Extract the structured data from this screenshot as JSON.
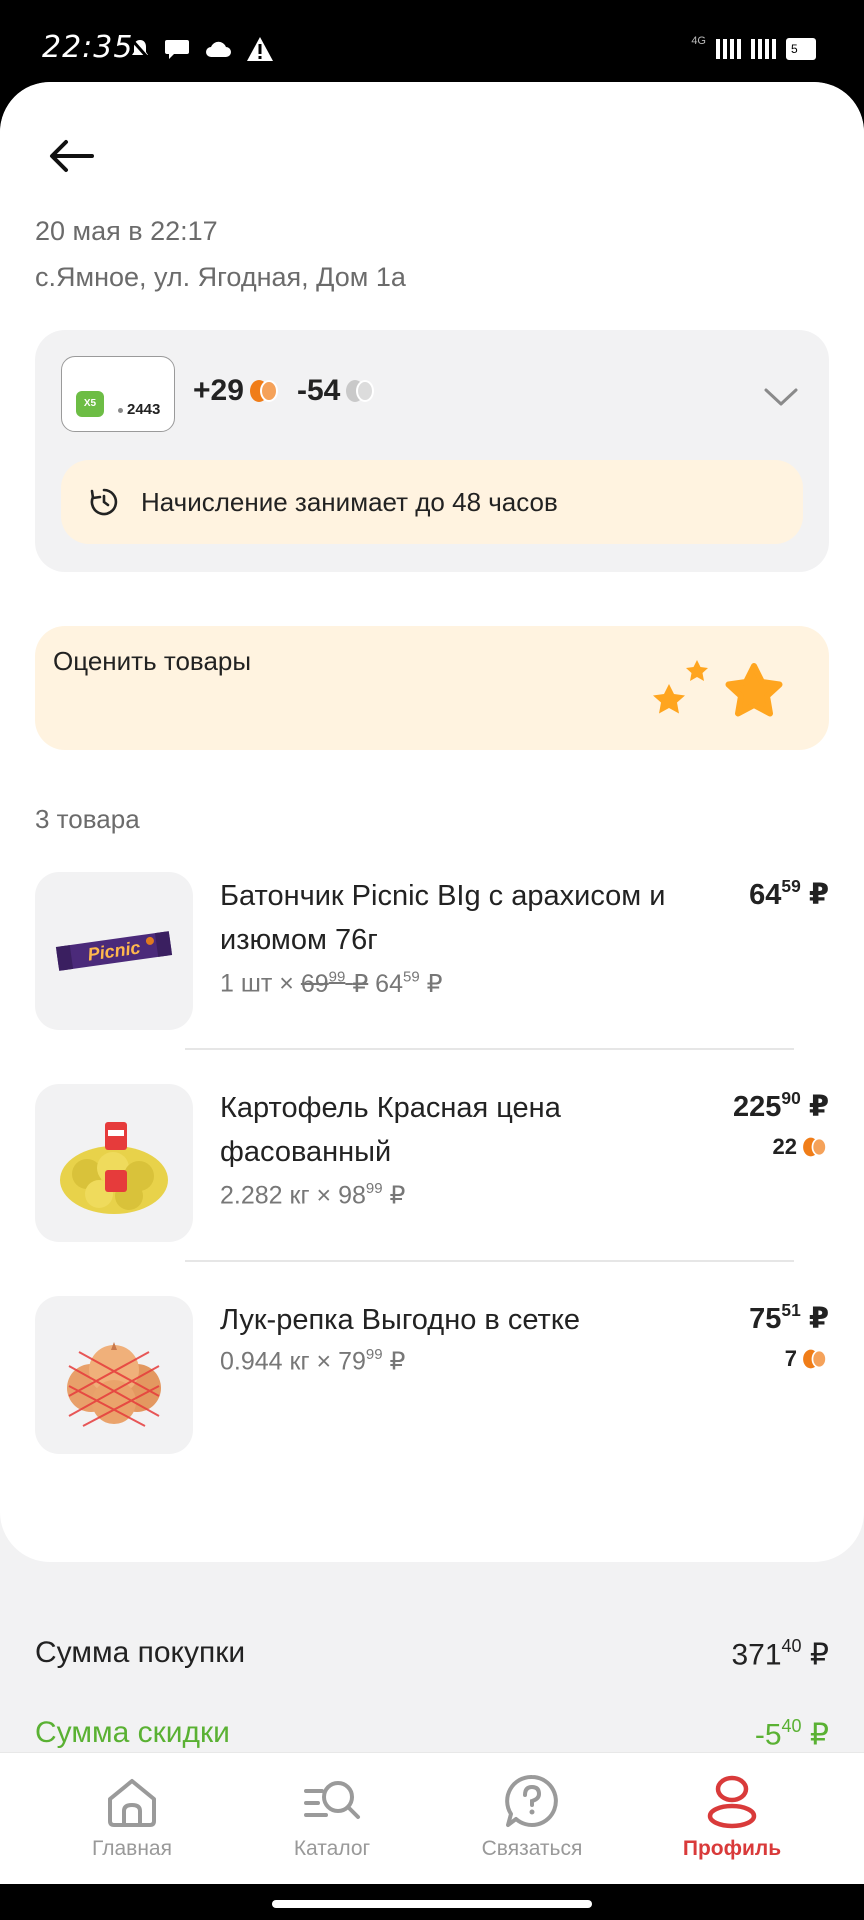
{
  "status_bar": {
    "time": "22:35",
    "network_label": "4G",
    "battery_level": "5"
  },
  "order": {
    "date": "20 мая в 22:17",
    "address": "с.Ямное, ул. Ягодная, Дом 1а"
  },
  "bonus": {
    "card_number": "2443",
    "card_logo_text": "X5",
    "points_earned": "+29",
    "points_spent": "-54",
    "accrual_note": "Начисление занимает до 48 часов"
  },
  "rate_banner": {
    "label": "Оценить товары"
  },
  "items_count": "3 товара",
  "items": [
    {
      "name": "Батончик Picnic BIg с арахисом и изюмом 76г",
      "qty_prefix": "1 шт ×",
      "old_price_int": "69",
      "old_price_dec": "99",
      "old_price_currency": "₽",
      "new_price_int": "64",
      "new_price_dec": "59",
      "new_price_currency": "₽",
      "price_int": "64",
      "price_dec": "59",
      "currency": "₽"
    },
    {
      "name": "Картофель Красная цена фасованный",
      "qty_prefix": "2.282 кг ×",
      "unit_price_int": "98",
      "unit_price_dec": "99",
      "unit_price_currency": "₽",
      "price_int": "225",
      "price_dec": "90",
      "currency": "₽",
      "points": "22"
    },
    {
      "name": "Лук-репка Выгодно в сетке",
      "qty_prefix": "0.944 кг ×",
      "unit_price_int": "79",
      "unit_price_dec": "99",
      "unit_price_currency": "₽",
      "price_int": "75",
      "price_dec": "51",
      "currency": "₽",
      "points": "7"
    }
  ],
  "summary": {
    "total_label": "Сумма покупки",
    "total_int": "371",
    "total_dec": "40",
    "total_currency": "₽",
    "discount_label": "Сумма скидки",
    "discount_int": "-5",
    "discount_dec": "40",
    "discount_currency": "₽"
  },
  "nav": [
    {
      "label": "Главная",
      "icon": "home-icon"
    },
    {
      "label": "Каталог",
      "icon": "catalog-search-icon"
    },
    {
      "label": "Связаться",
      "icon": "help-chat-icon"
    },
    {
      "label": "Профиль",
      "icon": "profile-icon",
      "active": true
    }
  ],
  "colors": {
    "accent_active": "#d93a3a",
    "discount_green": "#5ab133",
    "banner_cream": "#fff3e0",
    "points_orange": "#f07d18",
    "star_orange": "#ffa51f"
  }
}
